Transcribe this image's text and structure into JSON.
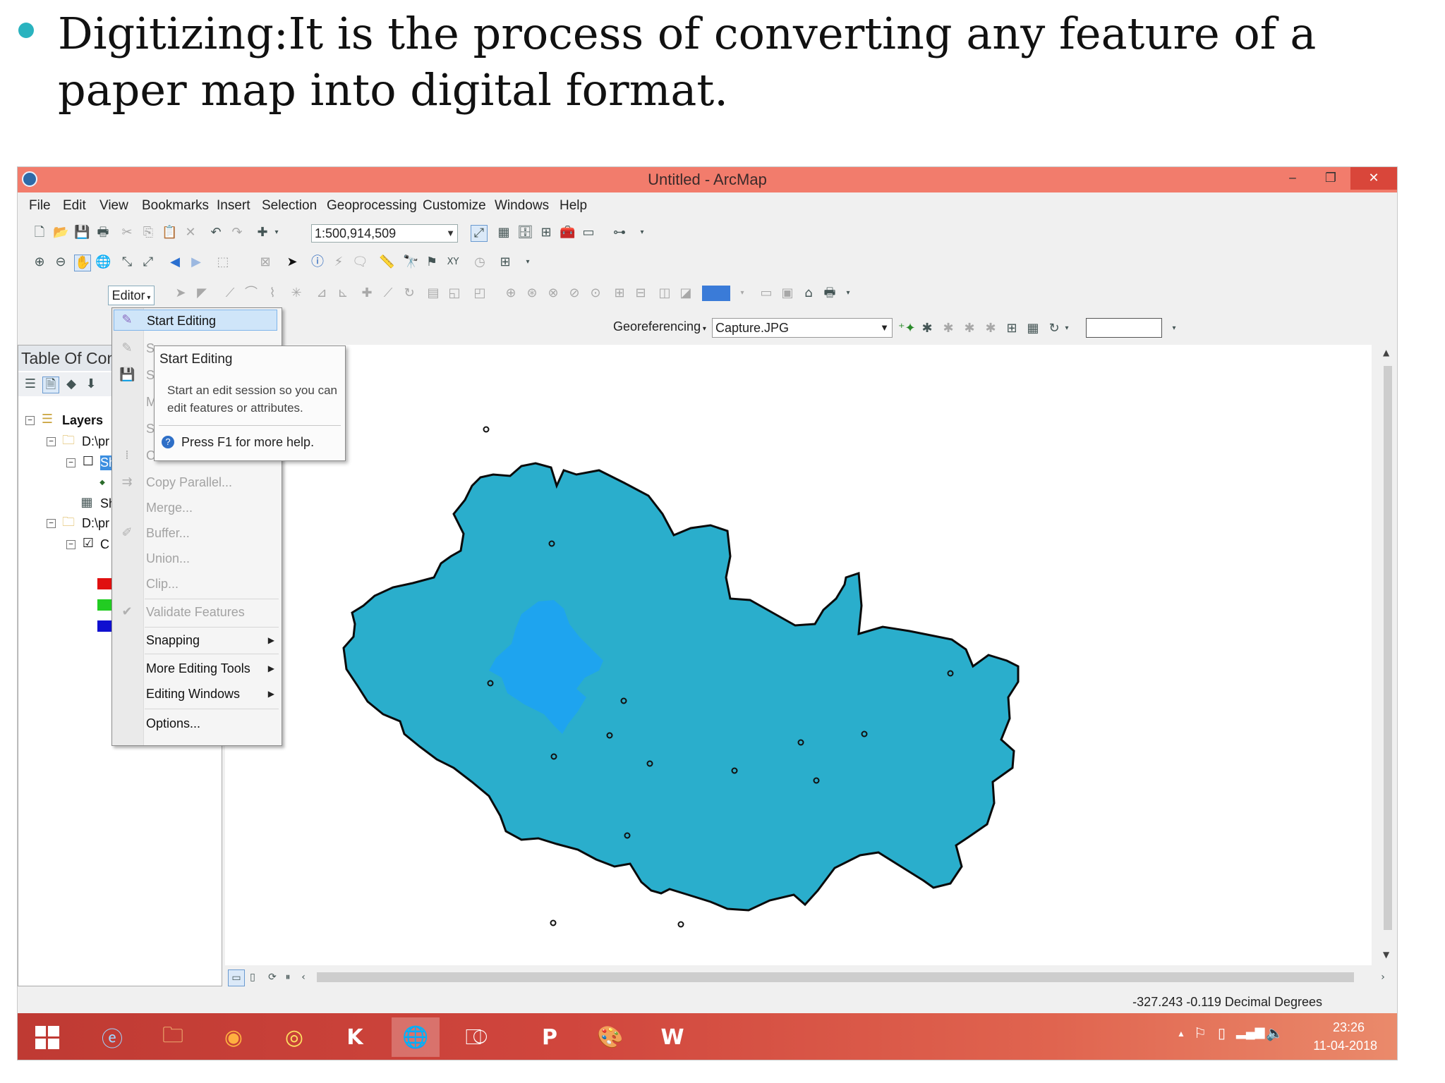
{
  "slide": {
    "title": "Digitizing:It is the process of converting any feature of a paper map into digital format."
  },
  "window": {
    "title": "Untitled - ArcMap",
    "minimize": "‒",
    "maximize": "❐",
    "close": "✕"
  },
  "menubar": [
    "File",
    "Edit",
    "View",
    "Bookmarks",
    "Insert",
    "Selection",
    "Geoprocessing",
    "Customize",
    "Windows",
    "Help"
  ],
  "standard_toolbar": {
    "scale": "1:500,914,509"
  },
  "editor_toolbar": {
    "label": "Editor"
  },
  "georef": {
    "label": "Georeferencing",
    "layer": "Capture.JPG"
  },
  "editor_menu": {
    "start_editing": "Start Editing",
    "copy_parallel": "Copy Parallel...",
    "merge": "Merge...",
    "buffer": "Buffer...",
    "union": "Union...",
    "clip": "Clip...",
    "validate": "Validate Features",
    "snapping": "Snapping",
    "more_tools": "More Editing Tools",
    "editing_windows": "Editing Windows",
    "options": "Options...",
    "hidden_initials": [
      "S",
      "S",
      "M",
      "S",
      "C"
    ]
  },
  "tooltip": {
    "title": "Start Editing",
    "body": "Start an edit session so you can edit features or attributes.",
    "help": "Press F1 for more help."
  },
  "toc": {
    "title": "Table Of Con",
    "layers": "Layers",
    "path1": "D:\\pr",
    "sh_item": "Sh",
    "sh_table": "Sh",
    "path2": "D:\\pr",
    "c_item": "C",
    "swatches": [
      "#e01010",
      "#22cc22",
      "#1010d0"
    ]
  },
  "map": {
    "polygon_fill": "#2aaecc",
    "highlight_fill": "#1ea4ef"
  },
  "statusbar": {
    "coords": "-327.243  -0.119 Decimal Degrees"
  },
  "taskbar": {
    "time": "23:26",
    "date": "11-04-2018",
    "apps": [
      "start-icon",
      "internet-explorer-icon",
      "file-explorer-icon",
      "firefox-icon",
      "chrome-icon",
      "kaspersky-icon",
      "arcmap-icon",
      "acrobat-icon",
      "powerpoint-icon",
      "paint-icon",
      "word-icon"
    ]
  }
}
